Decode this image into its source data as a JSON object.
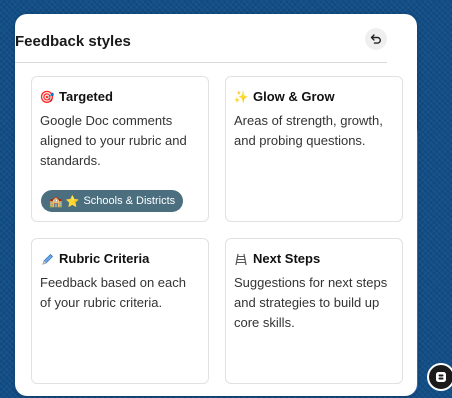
{
  "panel": {
    "title": "Feedback styles"
  },
  "cards": [
    {
      "icon": "target-icon",
      "emoji": "🎯",
      "title": "Targeted",
      "description": "Google Doc comments aligned to your rubric and standards.",
      "badge": {
        "emoji": "🏫 ⭐",
        "label": "Schools & Districts"
      }
    },
    {
      "icon": "sparkles-icon",
      "emoji": "✨",
      "title": "Glow & Grow",
      "description": "Areas of strength, growth, and probing questions."
    },
    {
      "icon": "pencil-icon",
      "emoji": "✏",
      "title": "Rubric Criteria",
      "description": "Feedback based on each of your rubric criteria."
    },
    {
      "icon": "ladder-icon",
      "emoji": "🪜",
      "title": "Next Steps",
      "description": "Suggestions for next steps and strategies to build up core skills."
    }
  ],
  "colors": {
    "background": "#0f4d86",
    "badge": "#4c6f80",
    "accent_border": "#3f6fd0"
  }
}
